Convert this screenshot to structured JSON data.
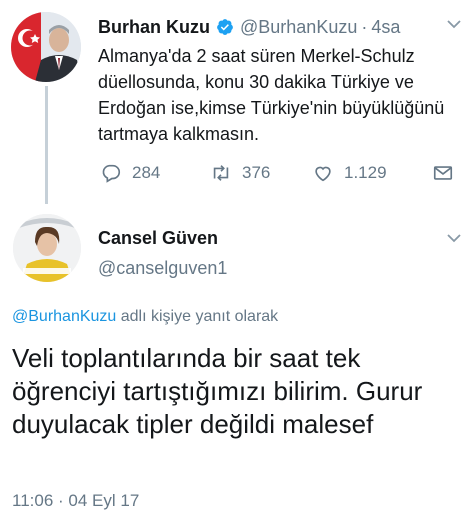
{
  "tweet1": {
    "author_name": "Burhan Kuzu",
    "verified_icon": "verified-badge-icon",
    "handle": "@BurhanKuzu",
    "separator": "·",
    "time": "4sa",
    "text": "Almanya'da 2 saat süren Merkel-Schulz düellosunda, konu 30 dakika Türkiye ve Erdoğan ise,kimse Türkiye'nin büyüklüğünü tartmaya kalkmasın.",
    "actions": {
      "reply_count": "284",
      "retweet_count": "376",
      "like_count": "1.129"
    }
  },
  "tweet2": {
    "author_name": "Cansel Güven",
    "handle": "@canselguven1",
    "reply_to_mention": "@BurhanKuzu",
    "reply_to_suffix": " adlı kişiye yanıt olarak",
    "text": "Veli toplantılarında bir saat tek öğrenciyi tartıştığımızı bilirim. Gurur duyulacak tipler değildi malesef",
    "timestamp": "11:06 · 04 Eyl 17"
  },
  "colors": {
    "text": "#14171a",
    "muted": "#657786",
    "accent": "#1b95e0",
    "verified": "#1da1f2",
    "thread_line": "#c6d0d8"
  }
}
